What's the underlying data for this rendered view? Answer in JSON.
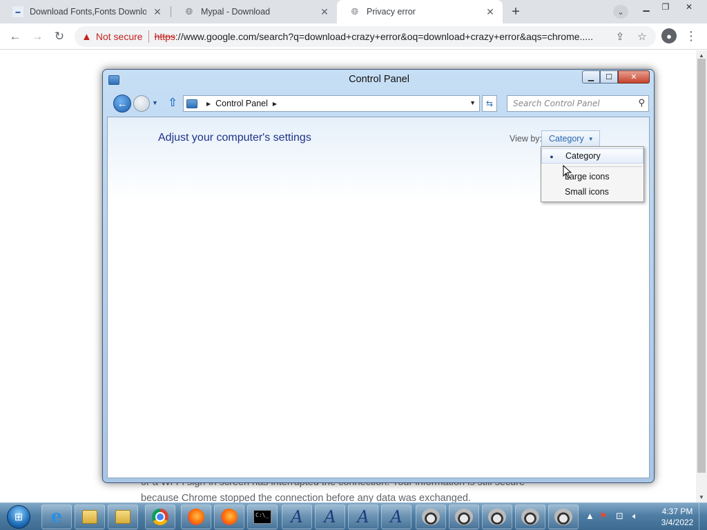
{
  "browser": {
    "tabs": [
      {
        "title": "Download Fonts,Fonts Download",
        "icon": "site-favicon"
      },
      {
        "title": "Mypal - Download",
        "icon": "globe-icon"
      },
      {
        "title": "Privacy error",
        "icon": "globe-icon"
      }
    ],
    "new_tab_label": "+",
    "security_label": "Not secure",
    "url_scheme": "https",
    "url_rest": "://www.google.com/search?q=download+crazy+error&oq=download+crazy+error&aqs=chrome.....",
    "icons": {
      "back": "arrow-left-icon",
      "forward": "arrow-right-icon",
      "reload": "reload-icon",
      "warning": "warning-icon",
      "share": "share-icon",
      "bookmark": "star-icon",
      "profile": "profile-icon",
      "menu": "kebab-menu-icon"
    }
  },
  "page": {
    "line1": "or a Wi-Fi sign-in screen has interrupted the connection. Your information is still secure",
    "line2": "because Chrome stopped the connection before any data was exchanged."
  },
  "control_panel": {
    "title": "Control Panel",
    "address_crumb": "Control Panel",
    "search_placeholder": "Search Control Panel",
    "heading": "Adjust your computer's settings",
    "view_by_label": "View by:",
    "view_by_value": "Category",
    "menu_items": [
      {
        "label": "Category",
        "checked": true
      },
      {
        "label": "Large icons",
        "checked": false
      },
      {
        "label": "Small icons",
        "checked": false
      }
    ]
  },
  "taskbar": {
    "time": "4:37 PM",
    "date": "3/4/2022",
    "cmd_text": "C:\\_"
  }
}
